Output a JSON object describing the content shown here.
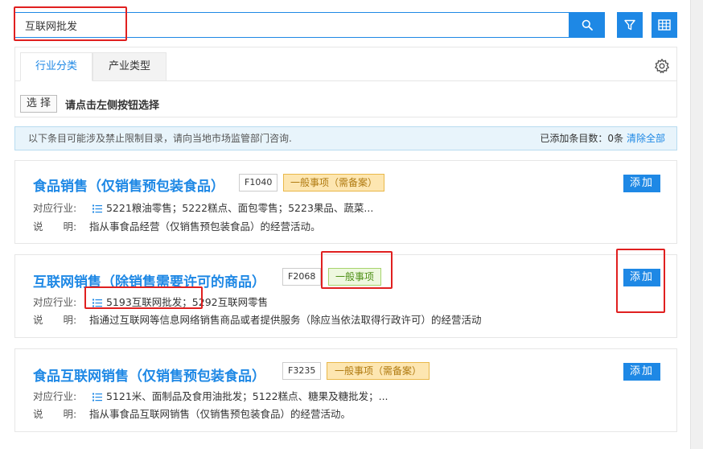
{
  "search": {
    "value": "互联网批发",
    "search_icon": "search-icon",
    "filter_icon": "filter-icon",
    "grid_icon": "table-grid-icon"
  },
  "tabs": [
    {
      "label": "行业分类",
      "active": true
    },
    {
      "label": "产业类型",
      "active": false
    }
  ],
  "selector": {
    "button_label": "选 择",
    "hint": "请点击左侧按钮选择"
  },
  "notice": {
    "text": "以下条目可能涉及禁止限制目录，请向当地市场监管部门咨询.",
    "count_text": "已添加条目数：0条",
    "clear_label": "清除全部"
  },
  "labels": {
    "industry": "对应行业:",
    "description": "说　　明:",
    "add": "添加"
  },
  "items": [
    {
      "title": "食品销售（仅销售预包装食品）",
      "code": "F1040",
      "type": "一般事项（需备案）",
      "industry": "5221粮油零售；5222糕点、面包零售；5223果品、蔬菜...",
      "description": "指从事食品经营（仅销售预包装食品）的经营活动。"
    },
    {
      "title": "互联网销售（除销售需要许可的商品）",
      "code": "F2068",
      "type": "一般事项",
      "industry": "5193互联网批发；5292互联网零售",
      "description": "指通过互联网等信息网络销售商品或者提供服务（除应当依法取得行政许可）的经营活动"
    },
    {
      "title": "食品互联网销售（仅销售预包装食品）",
      "code": "F3235",
      "type": "一般事项（需备案）",
      "industry": "5121米、面制品及食用油批发；5122糕点、糖果及糖批发；...",
      "description": "指从事食品互联网销售（仅销售预包装食品）的经营活动。"
    }
  ],
  "colors": {
    "accent": "#1e88e5",
    "annotation": "#e02020",
    "tag_yellow": "#fde6b1",
    "tag_green": "#eef8df"
  }
}
